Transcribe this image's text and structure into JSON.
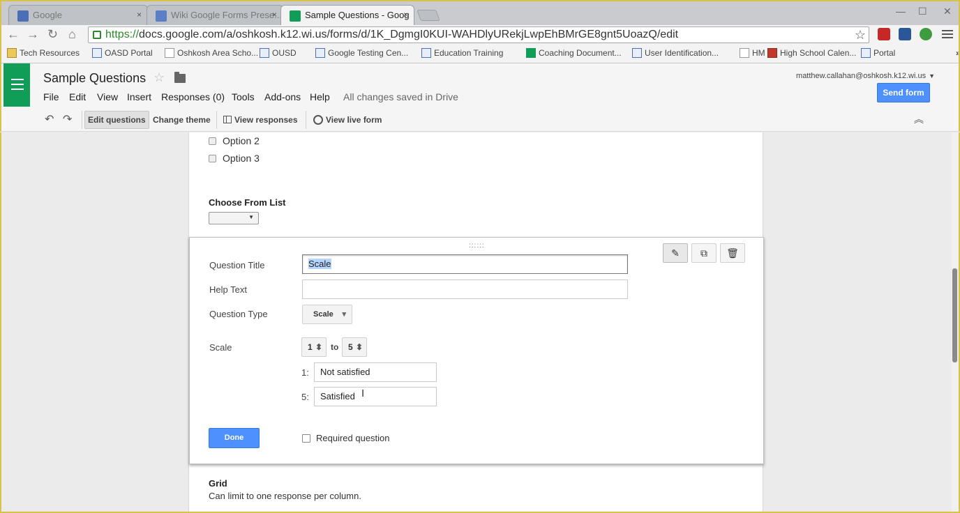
{
  "browser": {
    "tabs": [
      {
        "label": "Google",
        "favicon": "google-icon"
      },
      {
        "label": "Wiki Google Forms Prese...",
        "favicon": "sites-icon"
      },
      {
        "label": "Sample Questions - Goog",
        "favicon": "forms-icon",
        "active": true
      }
    ],
    "url_scheme": "https://",
    "url_rest": "docs.google.com/a/oshkosh.k12.wi.us/forms/d/1K_DgmgI0KUI-WAHDlyURekjLwpEhBMrGE8gnt5UoazQ/edit",
    "bookmarks": [
      "Tech Resources",
      "OASD Portal",
      "Oshkosh Area Scho...",
      "OUSD",
      "Google Testing Cen...",
      "Education Training",
      "Coaching Document...",
      "User Identification...",
      "HM",
      "High School Calen...",
      "Portal"
    ]
  },
  "app": {
    "doc_title": "Sample Questions",
    "menu": [
      "File",
      "Edit",
      "View",
      "Insert",
      "Responses (0)",
      "Tools",
      "Add-ons",
      "Help"
    ],
    "save_status": "All changes saved in Drive",
    "account": "matthew.callahan@oshkosh.k12.wi.us",
    "send_form": "Send form",
    "toolbar": {
      "edit_questions": "Edit questions",
      "change_theme": "Change theme",
      "view_responses": "View responses",
      "view_live_form": "View live form"
    }
  },
  "form": {
    "options": [
      "Option 2",
      "Option 3"
    ],
    "choose_from_list_title": "Choose From List",
    "editor": {
      "question_title_label": "Question Title",
      "question_title_value": "Scale",
      "help_text_label": "Help Text",
      "help_text_value": "",
      "question_type_label": "Question Type",
      "question_type_value": "Scale",
      "scale_label": "Scale",
      "scale_from": "1",
      "scale_to_word": "to",
      "scale_to": "5",
      "low_num": "1:",
      "low_label": "Not satisfied",
      "high_num": "5:",
      "high_label": "Satisfied",
      "done": "Done",
      "required": "Required question"
    },
    "grid_title": "Grid",
    "grid_help": "Can limit to one response per column."
  },
  "colors": {
    "forms_green": "#0f9d58",
    "primary_blue": "#4d90fe",
    "frame_yellow": "#d8c24a"
  }
}
